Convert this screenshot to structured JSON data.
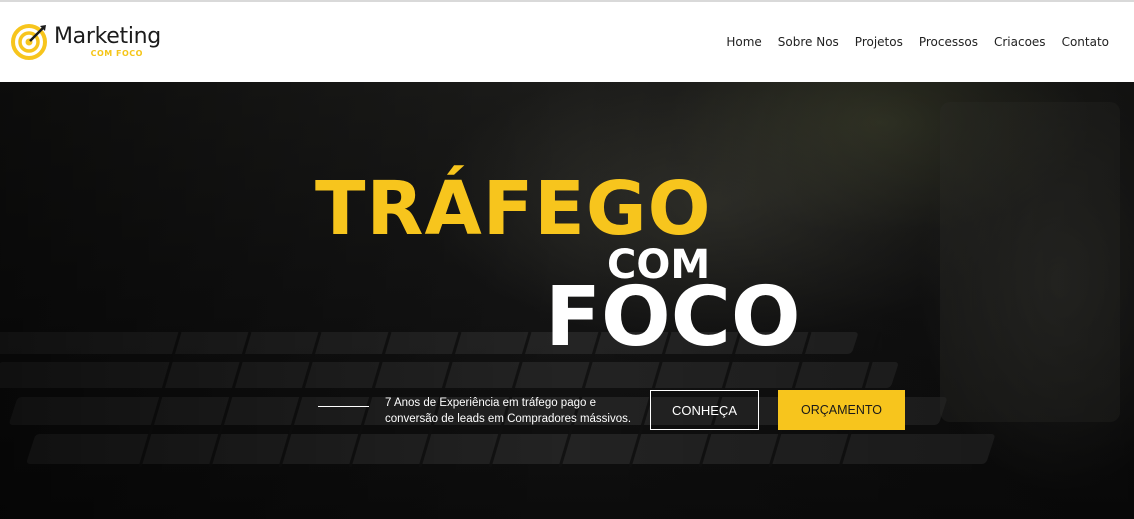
{
  "brand": {
    "name": "Marketing",
    "tagline": "COM FOCO",
    "accent_color": "#f7c51d"
  },
  "nav": {
    "items": [
      {
        "label": "Home"
      },
      {
        "label": "Sobre Nos"
      },
      {
        "label": "Projetos"
      },
      {
        "label": "Processos"
      },
      {
        "label": "Criacoes"
      },
      {
        "label": "Contato"
      }
    ]
  },
  "hero": {
    "title_line1": "TRÁFEGO",
    "title_line2": "COM",
    "title_line3": "FOCO",
    "description": "7 Anos de Experiência em tráfego pago e conversão de leads em Compradores mássivos.",
    "primary_button": "CONHEÇA",
    "secondary_button": "ORÇAMENTO",
    "background_icon": "keyboard-photo"
  }
}
